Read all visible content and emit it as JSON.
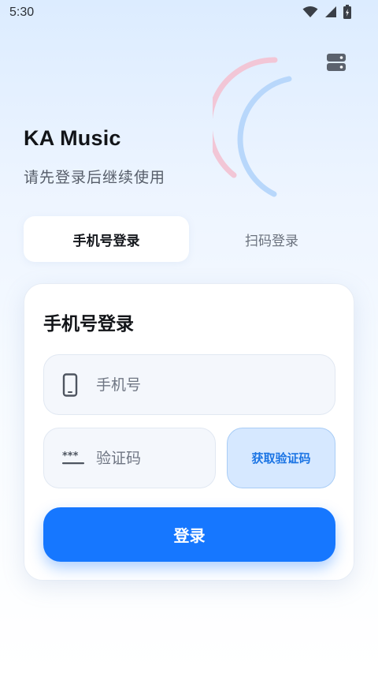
{
  "status_bar": {
    "time": "5:30"
  },
  "header": {
    "app_title": "KA Music",
    "subtitle": "请先登录后继续使用"
  },
  "tabs": [
    {
      "label": "手机号登录",
      "active": true
    },
    {
      "label": "扫码登录",
      "active": false
    }
  ],
  "form": {
    "title": "手机号登录",
    "phone_placeholder": "手机号",
    "phone_value": "",
    "code_placeholder": "验证码",
    "code_value": "",
    "get_code_label": "获取验证码",
    "login_label": "登录"
  },
  "colors": {
    "accent": "#1677ff",
    "accent_light": "#d6e8ff",
    "decor_pink": "#f2c6d6",
    "decor_blue": "#b8d7fb"
  },
  "icons": {
    "menu": "server-menu-icon",
    "phone": "smartphone-icon",
    "code": "password-dots-icon",
    "wifi": "wifi-icon",
    "signal": "cell-signal-icon",
    "battery": "battery-charging-icon"
  }
}
